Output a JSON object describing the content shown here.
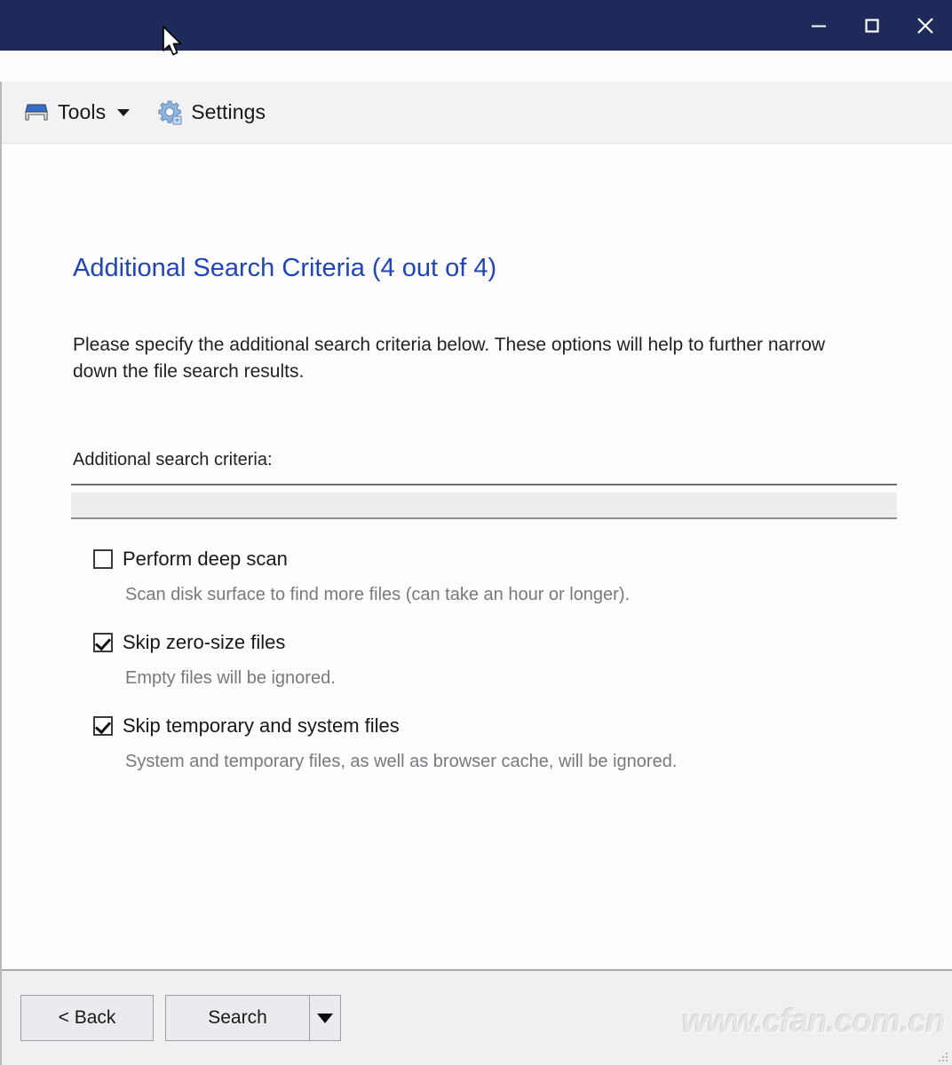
{
  "window": {
    "titlebar_color": "#1e2a5a",
    "controls": [
      {
        "name": "minimize",
        "glyph": "minimize-icon"
      },
      {
        "name": "maximize",
        "glyph": "maximize-icon"
      },
      {
        "name": "close",
        "glyph": "close-icon"
      }
    ]
  },
  "toolbar": {
    "items": [
      {
        "label": "Tools",
        "icon": "disk-drive-icon",
        "has_caret": true
      },
      {
        "label": "Settings",
        "icon": "gear-icon",
        "has_caret": false
      }
    ]
  },
  "page": {
    "title": "Additional Search Criteria (4 out of 4)",
    "description": "Please specify the additional search criteria below. These options will help to further narrow down the file search results.",
    "field_label": "Additional search criteria:",
    "criteria_value": ""
  },
  "options": [
    {
      "label": "Perform deep scan",
      "checked": false,
      "description": "Scan disk surface to find more files (can take an hour or longer)."
    },
    {
      "label": "Skip zero-size files",
      "checked": true,
      "description": "Empty files will be ignored."
    },
    {
      "label": "Skip temporary and system files",
      "checked": true,
      "description": "System and temporary files, as well as browser cache, will be ignored."
    }
  ],
  "footer": {
    "back_label": "< Back",
    "search_label": "Search",
    "dropdown_icon": "chevron-down-icon"
  },
  "watermark": {
    "text": "www.cfan.com.cn"
  },
  "colors": {
    "accent": "#1f46b4",
    "titlebar": "#1e2a5a",
    "muted_text": "#79787d"
  }
}
